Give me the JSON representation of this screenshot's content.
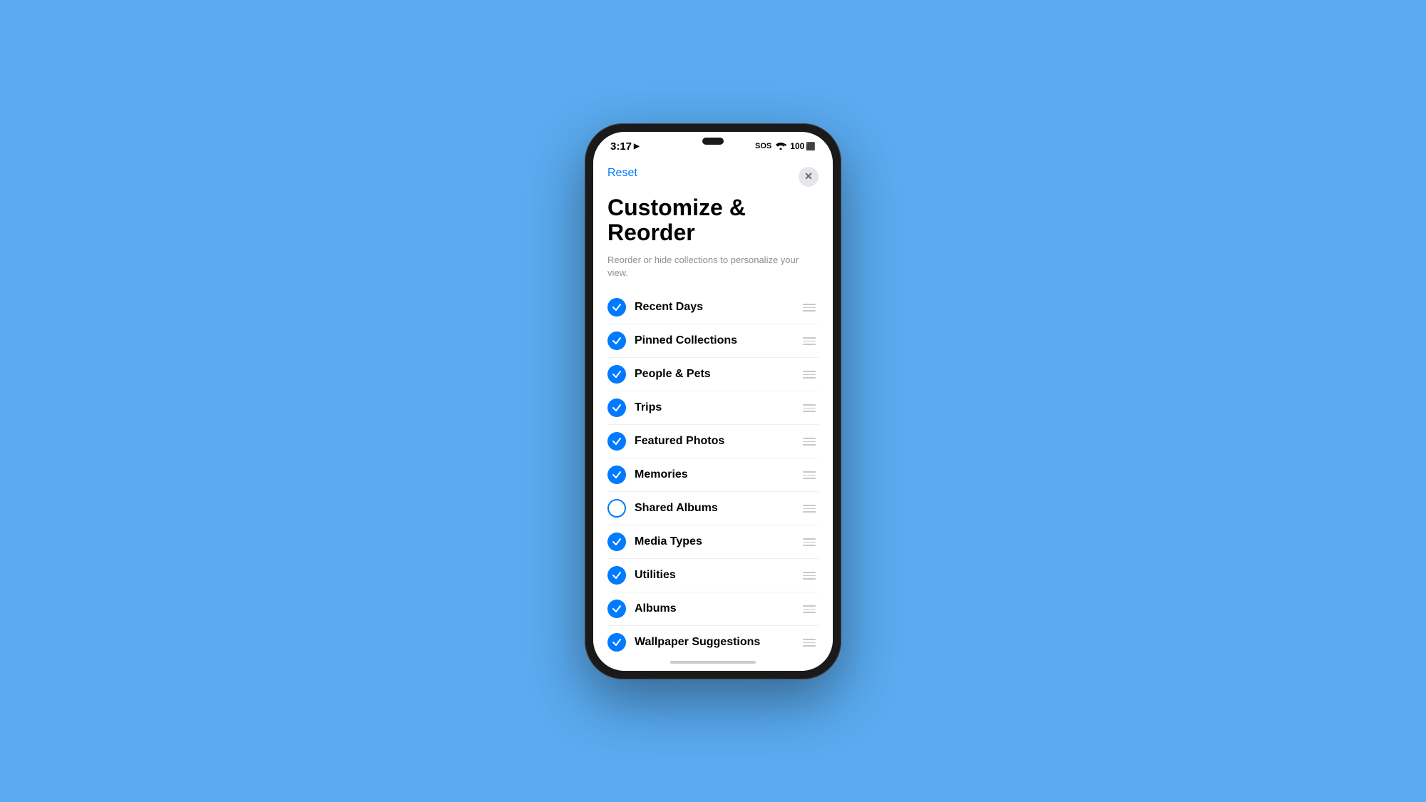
{
  "background": {
    "color": "#5aabf0"
  },
  "statusBar": {
    "time": "3:17",
    "locationIcon": "▶",
    "sos": "SOS",
    "wifi": "wifi",
    "battery": "100"
  },
  "modal": {
    "resetLabel": "Reset",
    "closeLabel": "✕",
    "title": "Customize &\nReorder",
    "subtitle": "Reorder or hide collections to personalize your view.",
    "items": [
      {
        "label": "Recent Days",
        "checked": true
      },
      {
        "label": "Pinned Collections",
        "checked": true
      },
      {
        "label": "People & Pets",
        "checked": true
      },
      {
        "label": "Trips",
        "checked": true
      },
      {
        "label": "Featured Photos",
        "checked": true
      },
      {
        "label": "Memories",
        "checked": true
      },
      {
        "label": "Shared Albums",
        "checked": false
      },
      {
        "label": "Media Types",
        "checked": true
      },
      {
        "label": "Utilities",
        "checked": true
      },
      {
        "label": "Albums",
        "checked": true
      },
      {
        "label": "Wallpaper Suggestions",
        "checked": true
      }
    ]
  }
}
